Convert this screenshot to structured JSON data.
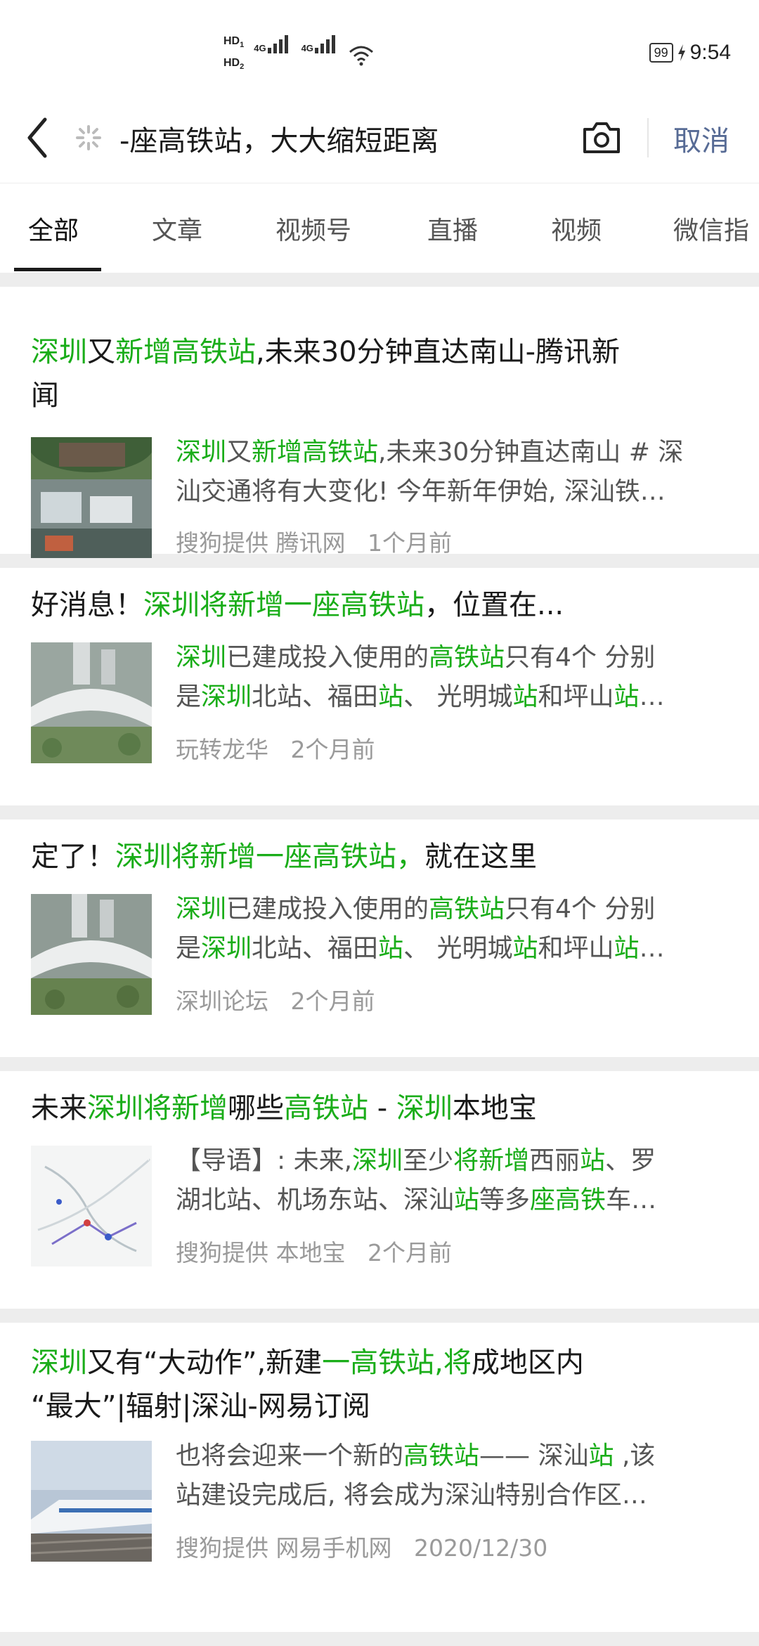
{
  "status_bar": {
    "hd1": "HD",
    "hd1_sub": "1",
    "hd2": "HD",
    "hd2_sub": "2",
    "sig1_tag": "4G",
    "sig2_tag": "4G",
    "battery": "99",
    "time": "9:54"
  },
  "search": {
    "query": "-座高铁站，大大缩短距离",
    "cancel": "取消"
  },
  "tabs": [
    "全部",
    "文章",
    "视频号",
    "直播",
    "视频",
    "微信指"
  ],
  "results": [
    {
      "title_l1": [
        {
          "t": "深圳",
          "h": true
        },
        {
          "t": "又",
          "h": false
        },
        {
          "t": "新增高铁站",
          "h": true
        },
        {
          "t": ",未来30分钟直达南山-腾讯新",
          "h": false
        }
      ],
      "title_l2": [
        {
          "t": "闻",
          "h": false
        }
      ],
      "snippet_l1": [
        {
          "t": "深圳",
          "h": true
        },
        {
          "t": "又",
          "h": false
        },
        {
          "t": "新增高铁站",
          "h": true
        },
        {
          "t": ",未来30分钟直达南山 # 深",
          "h": false
        }
      ],
      "snippet_l2": [
        {
          "t": "汕交通将有大变化! 今年新年伊始, 深汕铁…",
          "h": false
        }
      ],
      "source": "搜狗提供 腾讯网",
      "time": "1个月前"
    },
    {
      "title_l1": [
        {
          "t": "好消息！",
          "h": false
        },
        {
          "t": "深圳将新增一座高铁站",
          "h": true
        },
        {
          "t": "，位置在...",
          "h": false
        }
      ],
      "snippet_l1": [
        {
          "t": "深圳",
          "h": true
        },
        {
          "t": "已建成投入使用的",
          "h": false
        },
        {
          "t": "高铁站",
          "h": true
        },
        {
          "t": "只有4个 分别",
          "h": false
        }
      ],
      "snippet_l2": [
        {
          "t": "是",
          "h": false
        },
        {
          "t": "深圳",
          "h": true
        },
        {
          "t": "北站、福田",
          "h": false
        },
        {
          "t": "站",
          "h": true
        },
        {
          "t": "、 光明城",
          "h": false
        },
        {
          "t": "站",
          "h": true
        },
        {
          "t": "和坪山",
          "h": false
        },
        {
          "t": "站",
          "h": true
        },
        {
          "t": "…",
          "h": false
        }
      ],
      "source": "玩转龙华",
      "time": "2个月前"
    },
    {
      "title_l1": [
        {
          "t": "定了！",
          "h": false
        },
        {
          "t": "深圳将新增一座高铁站，",
          "h": true
        },
        {
          "t": "就在这里",
          "h": false
        }
      ],
      "snippet_l1": [
        {
          "t": "深圳",
          "h": true
        },
        {
          "t": "已建成投入使用的",
          "h": false
        },
        {
          "t": "高铁站",
          "h": true
        },
        {
          "t": "只有4个 分别",
          "h": false
        }
      ],
      "snippet_l2": [
        {
          "t": "是",
          "h": false
        },
        {
          "t": "深圳",
          "h": true
        },
        {
          "t": "北站、福田",
          "h": false
        },
        {
          "t": "站",
          "h": true
        },
        {
          "t": "、 光明城",
          "h": false
        },
        {
          "t": "站",
          "h": true
        },
        {
          "t": "和坪山",
          "h": false
        },
        {
          "t": "站",
          "h": true
        },
        {
          "t": "…",
          "h": false
        }
      ],
      "source": "深圳论坛",
      "time": "2个月前"
    },
    {
      "title_l1": [
        {
          "t": "未来",
          "h": false
        },
        {
          "t": "深圳将新增",
          "h": true
        },
        {
          "t": "哪些",
          "h": false
        },
        {
          "t": "高铁站",
          "h": true
        },
        {
          "t": " - ",
          "h": false
        },
        {
          "t": "深圳",
          "h": true
        },
        {
          "t": "本地宝",
          "h": false
        }
      ],
      "snippet_l1": [
        {
          "t": "【导语】: 未来,",
          "h": false
        },
        {
          "t": "深圳",
          "h": true
        },
        {
          "t": "至少",
          "h": false
        },
        {
          "t": "将新增",
          "h": true
        },
        {
          "t": "西丽",
          "h": false
        },
        {
          "t": "站",
          "h": true
        },
        {
          "t": "、罗",
          "h": false
        }
      ],
      "snippet_l2": [
        {
          "t": "湖北站、机场东站、深汕",
          "h": false
        },
        {
          "t": "站",
          "h": true
        },
        {
          "t": "等多",
          "h": false
        },
        {
          "t": "座高铁",
          "h": true
        },
        {
          "t": "车…",
          "h": false
        }
      ],
      "source": "搜狗提供 本地宝",
      "time": "2个月前"
    },
    {
      "title_l1": [
        {
          "t": "深圳",
          "h": true
        },
        {
          "t": "又有“大动作”,新建",
          "h": false
        },
        {
          "t": "一高铁站,将",
          "h": true
        },
        {
          "t": "成地区内",
          "h": false
        }
      ],
      "title_l2": [
        {
          "t": "“最大”|辐射|深汕-网易订阅",
          "h": false
        }
      ],
      "snippet_l1": [
        {
          "t": "也将会迎来一个新的",
          "h": false
        },
        {
          "t": "高铁站",
          "h": true
        },
        {
          "t": "—— 深汕",
          "h": false
        },
        {
          "t": "站",
          "h": true
        },
        {
          "t": " ,该",
          "h": false
        }
      ],
      "snippet_l2": [
        {
          "t": "站建设完成后, 将会成为深汕特别合作区…",
          "h": false
        }
      ],
      "source": "搜狗提供 网易手机网",
      "time": "2020/12/30"
    }
  ],
  "colors": {
    "highlight": "#1aad19",
    "cancel": "#576b95",
    "divider": "#ededed",
    "meta": "#9a9a9a"
  },
  "icons": [
    "back-chevron-icon",
    "loading-spinner-icon",
    "camera-icon",
    "signal-icon",
    "wifi-icon",
    "charging-icon"
  ]
}
